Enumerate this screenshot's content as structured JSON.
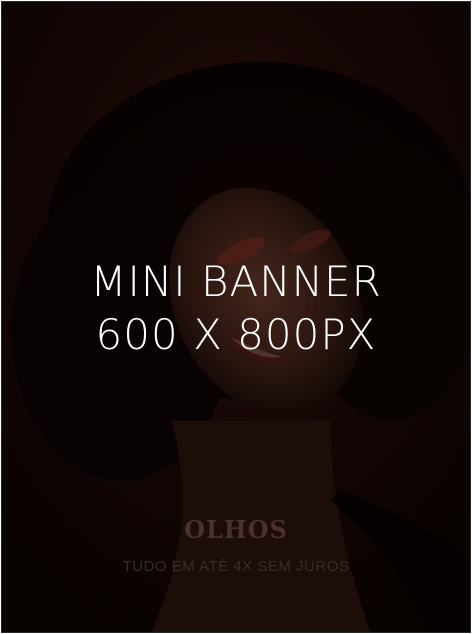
{
  "banner": {
    "line1": "MINI BANNER",
    "line2": "600 X 800PX",
    "title": "OLHOS",
    "subtitle": "TUDO EM ATÉ 4X SEM JUROS"
  },
  "colors": {
    "background": "#120605",
    "text": "#ffffff",
    "caption": "#4a2f33"
  }
}
